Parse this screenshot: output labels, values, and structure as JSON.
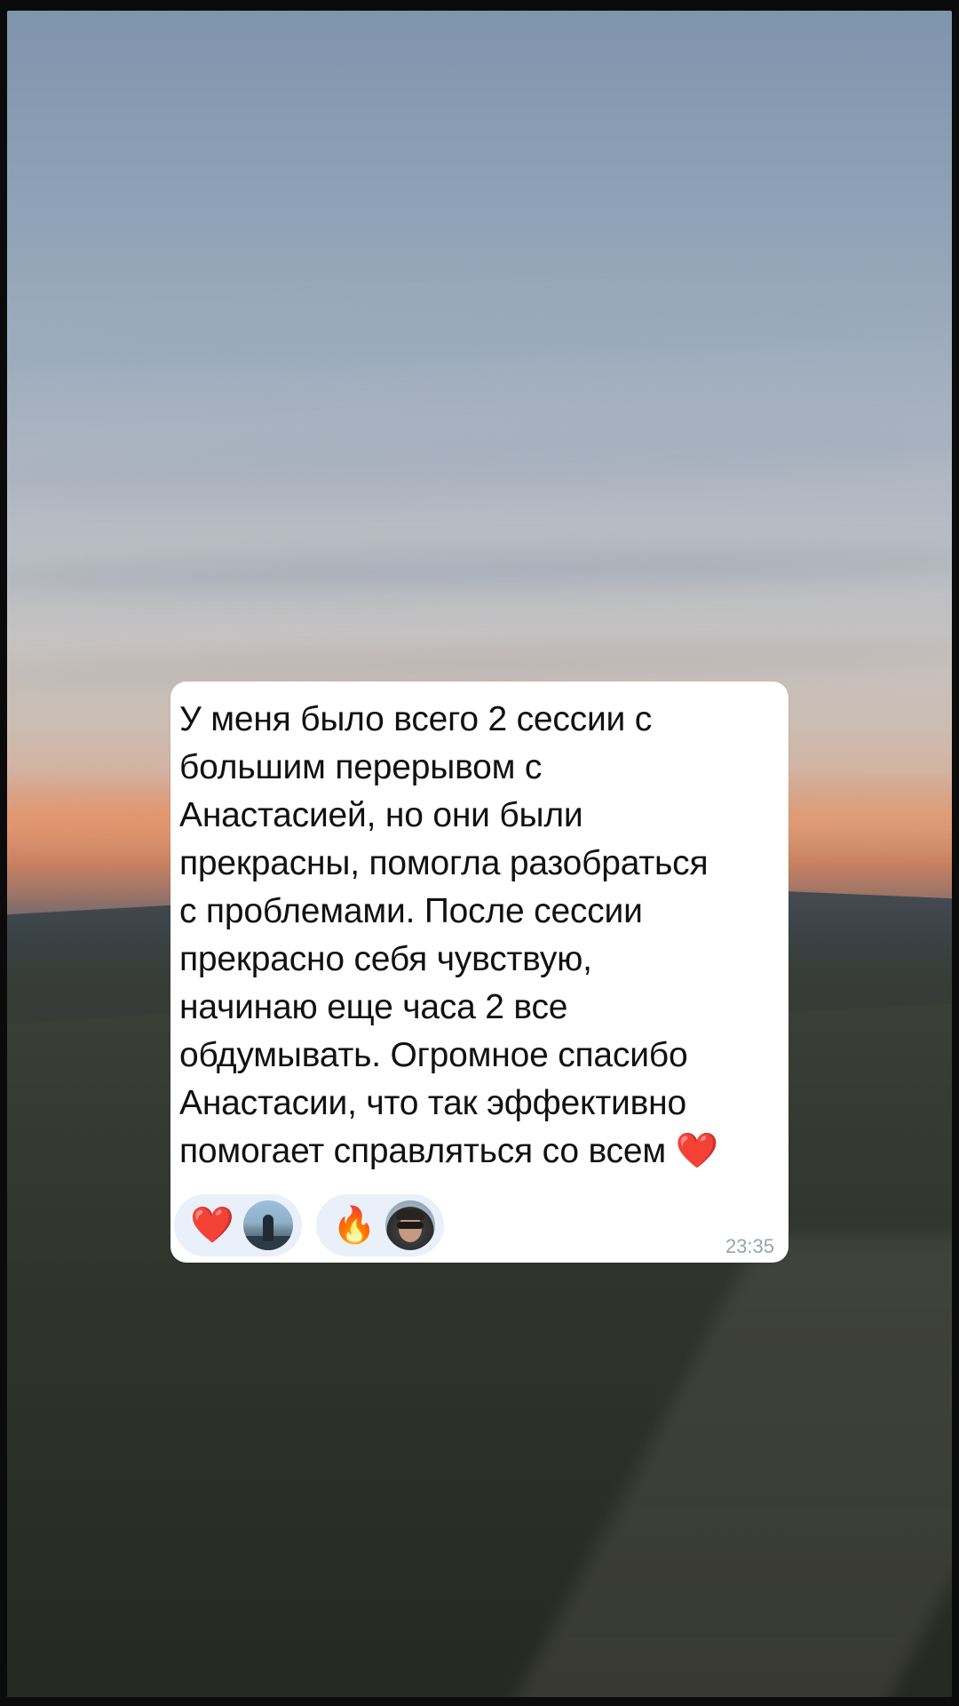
{
  "message": {
    "text": "У меня было всего 2 сессии с\nбольшим перерывом с\nАнастасией, но они были\nпрекрасны, помогла разобраться\nс проблемами. После сессии\nпрекрасно себя чувствую,\nначинаю еще часа 2 все\nобдумывать. Огромное спасибо\nАнастасии, что так эффективно\nпомогает справляться со всем ❤️",
    "time": "23:35"
  },
  "reactions": [
    {
      "emoji": "❤️",
      "icon": "red-heart-emoji"
    },
    {
      "emoji": "🔥",
      "icon": "fire-emoji"
    }
  ]
}
